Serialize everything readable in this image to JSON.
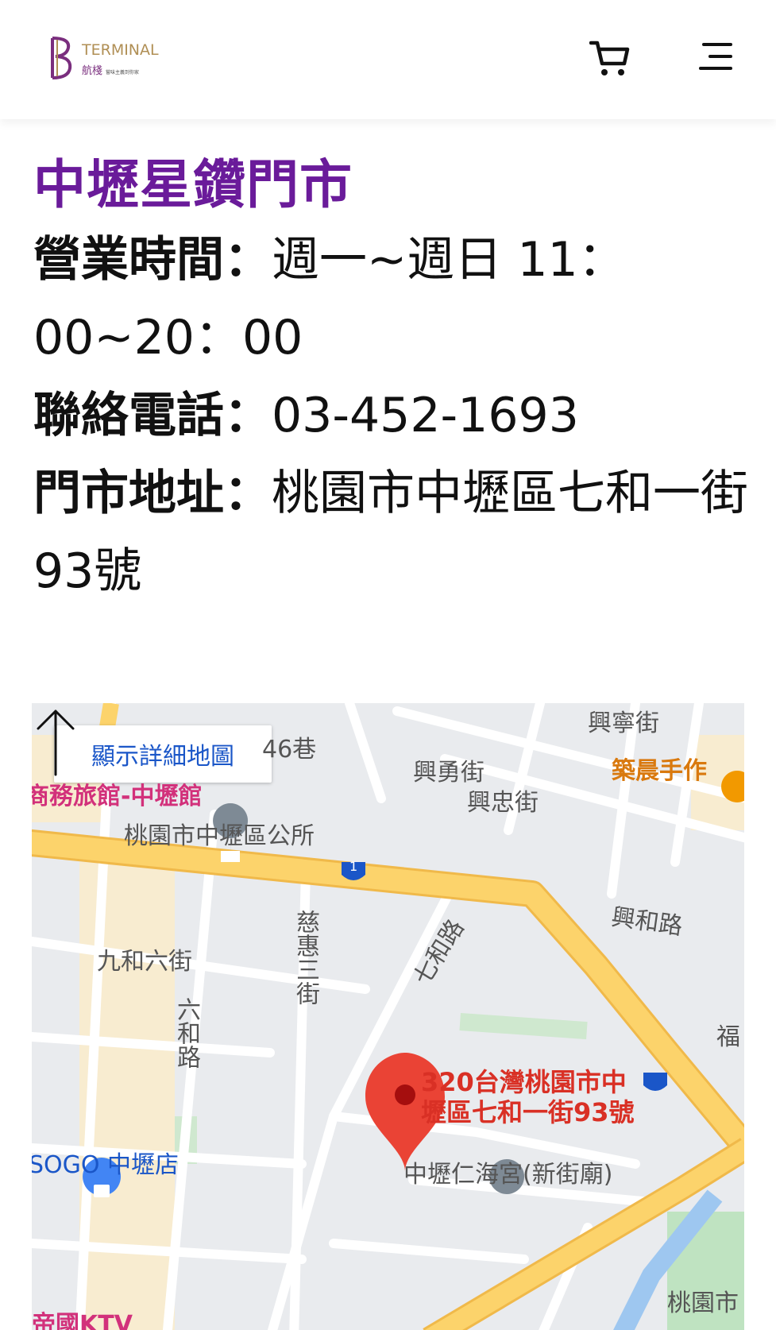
{
  "header": {
    "logo_brand": "TERMINAL",
    "logo_sub": "航棧",
    "logo_tagline": "嘗味主義到你家",
    "cart_icon": "cart-icon",
    "menu_icon": "hamburger-menu-icon"
  },
  "store": {
    "name": "中壢星鑽門市",
    "hours_label": "營業時間：",
    "hours_value": "週一~週日 11：00~20：00",
    "phone_label": "聯絡電話：",
    "phone_value": "03-452-1693",
    "address_label": "門市地址：",
    "address_value": "桃園市中壢區七和一街93號"
  },
  "map": {
    "detail_button": "顯示詳細地圖",
    "marker_label_line1": "320台灣桃園市中",
    "marker_label_line2": "壢區七和一街93號",
    "labels": {
      "lane46": "46巷",
      "xingning": "興寧街",
      "xingyong": "興勇街",
      "xingzhong": "興忠街",
      "zhuchen": "築晨手作",
      "hotel": "商務旅館-中壢館",
      "district_office": "桃園市中壢區公所",
      "jiuhe6": "九和六街",
      "cihui3": "慈惠三街",
      "qihe": "七和路",
      "xinghe": "興和路",
      "liuhe": "六和路",
      "fu": "福",
      "sogo": "SOGO 中壢店",
      "renhai": "中壢仁海宮(新街廟)",
      "ktv": "帝國KTV",
      "taoyuan": "桃園市",
      "route1": "1"
    },
    "colors": {
      "main_road": "#fcd36b",
      "road_edge": "#f0b94a",
      "background": "#e9ebee",
      "marker": "#ea4335"
    }
  },
  "scroll_top_icon": "up-arrow-icon"
}
